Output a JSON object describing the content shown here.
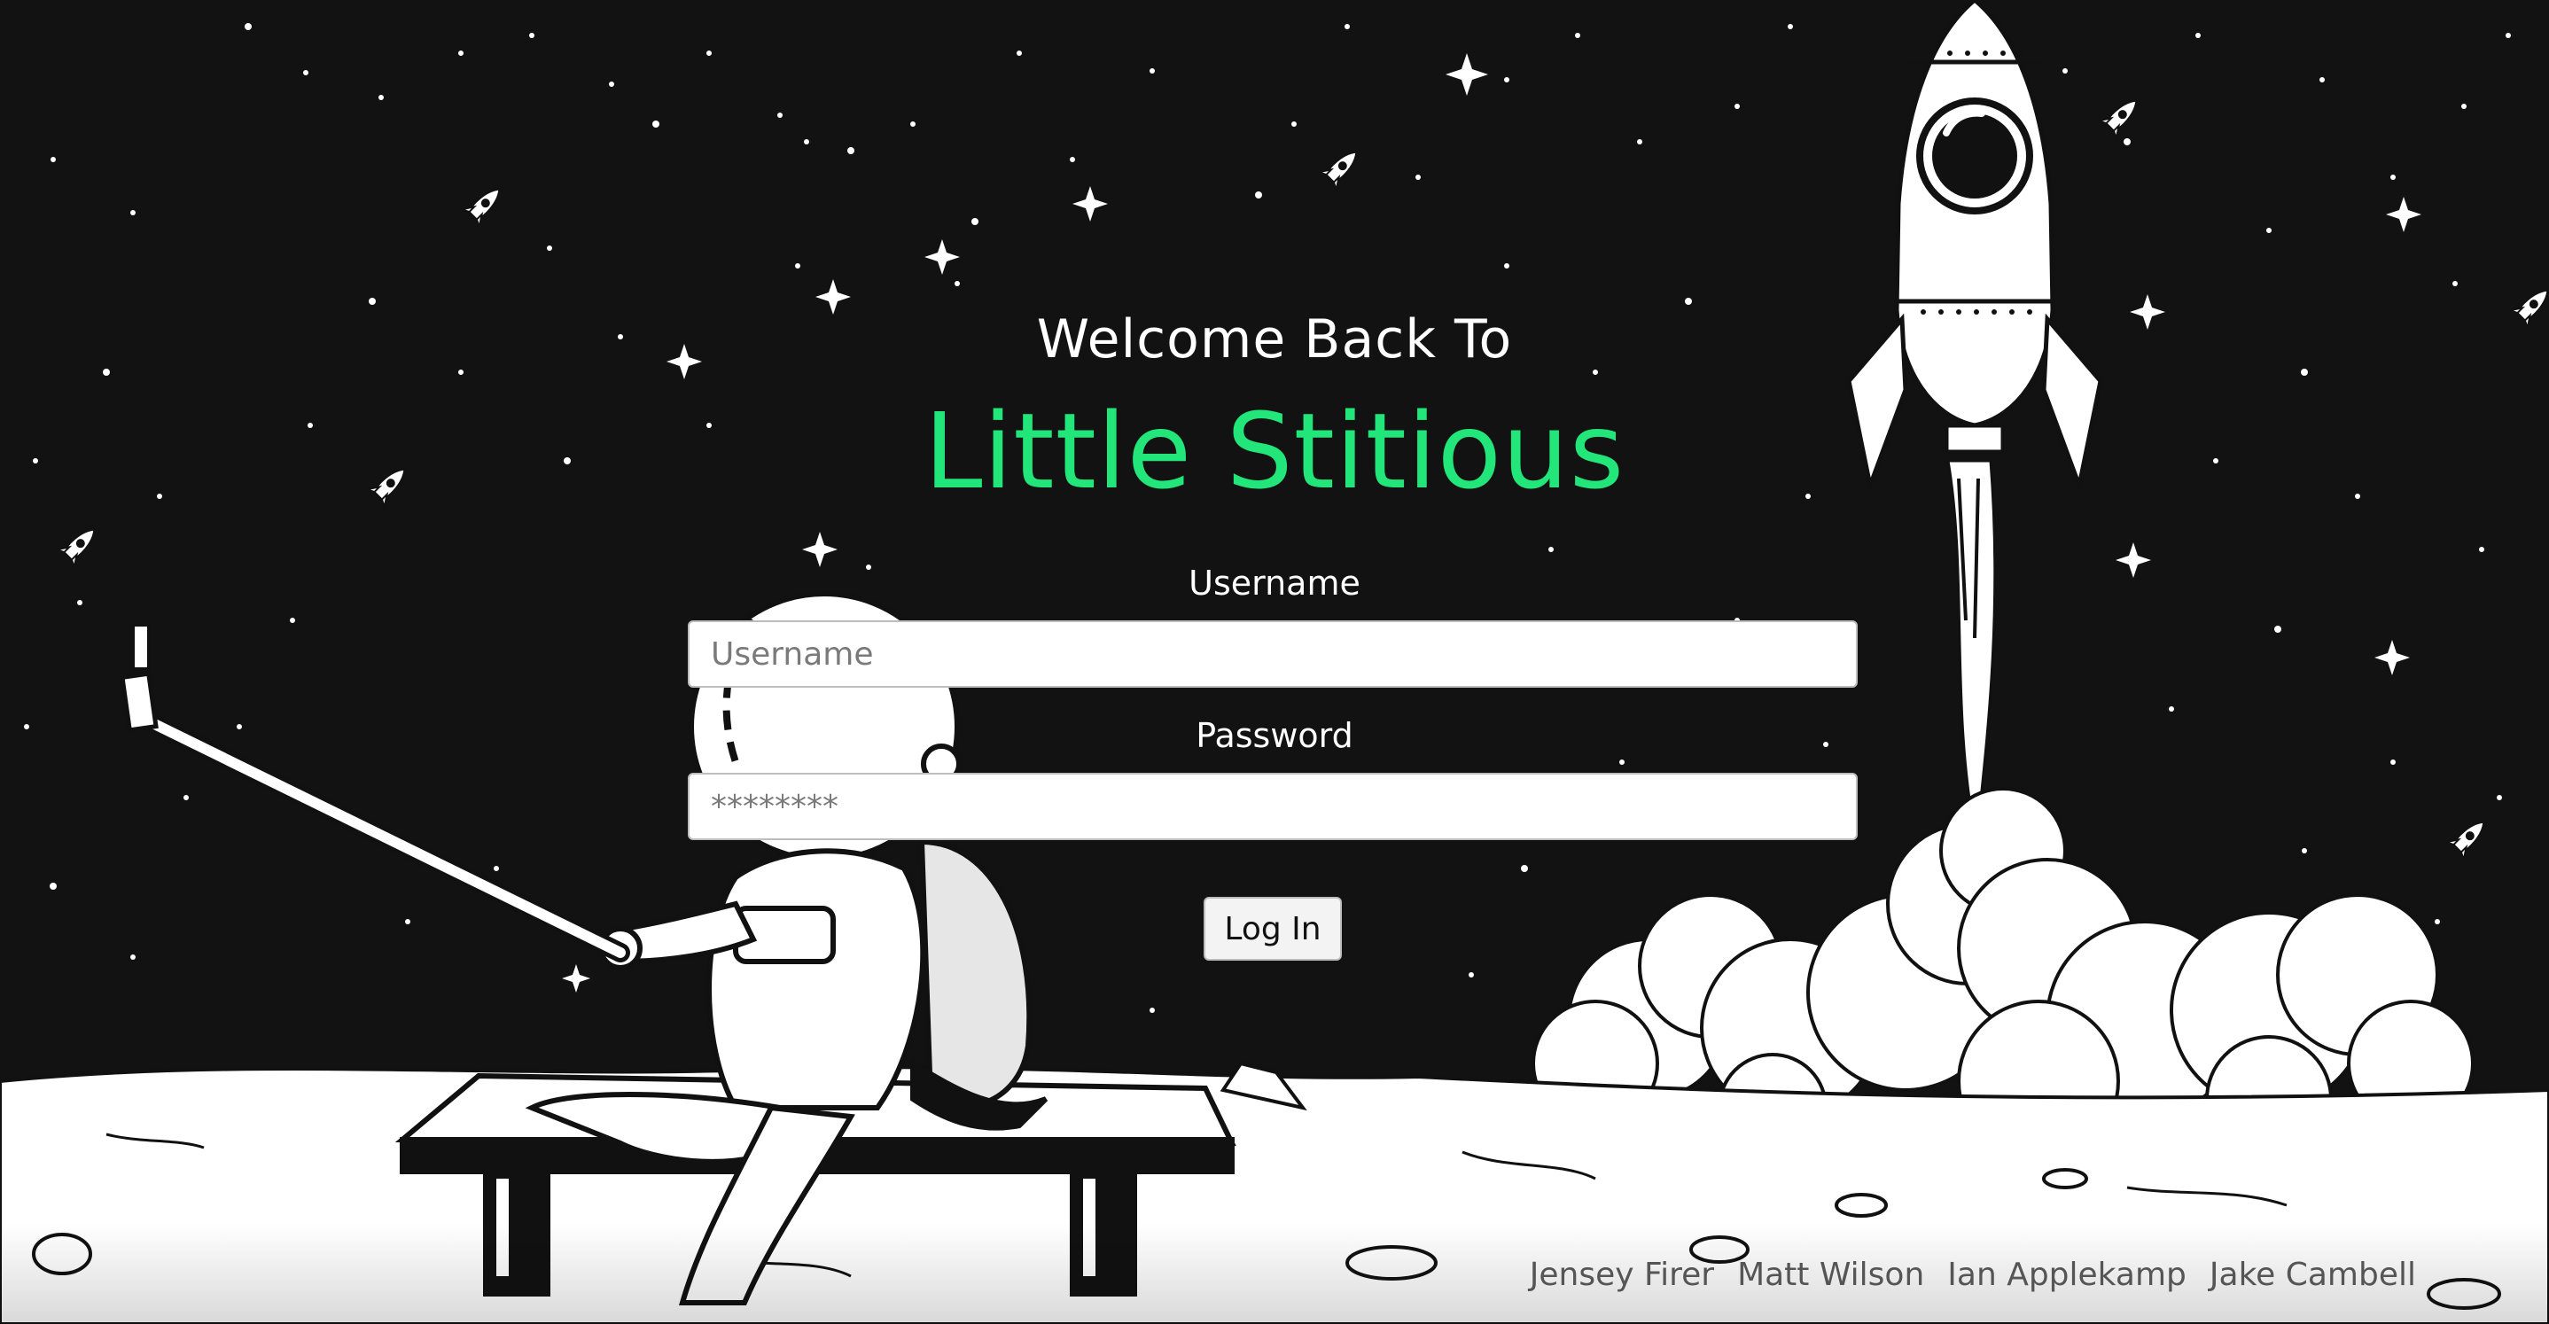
{
  "header": {
    "welcome_text": "Welcome Back To",
    "app_name": "Little Stitious"
  },
  "form": {
    "username_label": "Username",
    "username_placeholder": "Username",
    "password_label": "Password",
    "password_placeholder": "********",
    "login_button": "Log In"
  },
  "credits": [
    "Jensey Firer",
    "Matt Wilson",
    "Ian Applekamp",
    "Jake Cambell"
  ],
  "colors": {
    "background": "#121212",
    "brand_green": "#22e67a",
    "text_white": "#ffffff",
    "credits_gray": "#555555"
  },
  "icons": {
    "rocket": "rocket-icon",
    "star": "star-icon",
    "astronaut": "astronaut-illustration",
    "moon_surface": "moon-surface-illustration"
  }
}
